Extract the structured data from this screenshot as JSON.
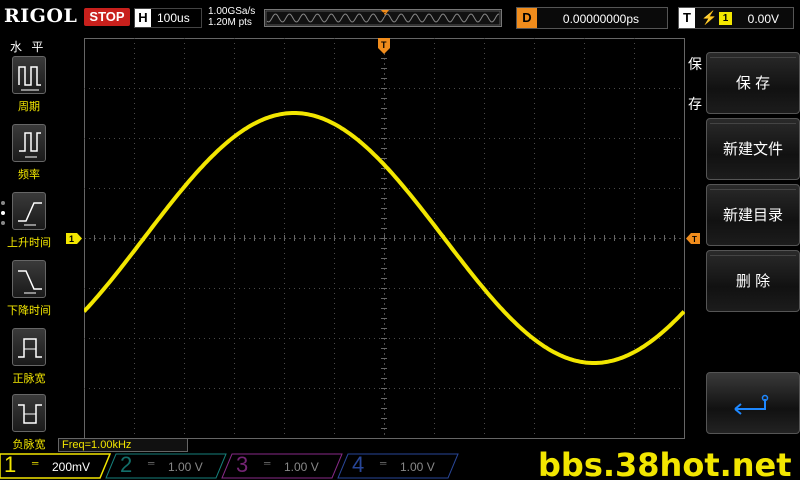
{
  "brand": "RIGOL",
  "run_state": "STOP",
  "horizontal": {
    "tag": "H",
    "timebase": "100us"
  },
  "acquisition": {
    "sample_rate": "1.00GSa/s",
    "memory_depth": "1.20M pts"
  },
  "delay": {
    "tag": "D",
    "value": "0.00000000ps"
  },
  "trigger": {
    "tag": "T",
    "edge_symbol": "⚡",
    "source": "1",
    "level": "0.00V"
  },
  "left_menu": {
    "title": "水 平",
    "items": [
      {
        "label": "周期",
        "icon": "period-icon"
      },
      {
        "label": "频率",
        "icon": "frequency-icon"
      },
      {
        "label": "上升时间",
        "icon": "rise-time-icon"
      },
      {
        "label": "下降时间",
        "icon": "fall-time-icon"
      },
      {
        "label": "正脉宽",
        "icon": "positive-width-icon"
      },
      {
        "label": "负脉宽",
        "icon": "negative-width-icon"
      }
    ]
  },
  "right_menu": {
    "title": "保存",
    "items": [
      {
        "label": "保 存"
      },
      {
        "label": "新建文件"
      },
      {
        "label": "新建目录"
      },
      {
        "label": "删 除"
      }
    ],
    "back_icon": "return-arrow-icon"
  },
  "measurement": {
    "freq": "Freq=1.00kHz"
  },
  "channels": [
    {
      "number": "1",
      "scale": "200mV",
      "color": "#f2e600",
      "active": true
    },
    {
      "number": "2",
      "scale": "1.00 V",
      "color": "#1fb8b0",
      "active": false
    },
    {
      "number": "3",
      "scale": "1.00 V",
      "color": "#c03cc0",
      "active": false
    },
    {
      "number": "4",
      "scale": "1.00 V",
      "color": "#3a64d8",
      "active": false
    }
  ],
  "waveform": {
    "type": "sine",
    "color": "#f2e600",
    "cycles_visible": 1.0,
    "amplitude_divs": 2.5,
    "start_phase_deg": 180
  },
  "colors": {
    "trace": "#f2e600",
    "trigger": "#f08c1c",
    "stop": "#c8201c",
    "grid": "#4a4a4a"
  },
  "watermark": "bbs.38hot.net"
}
